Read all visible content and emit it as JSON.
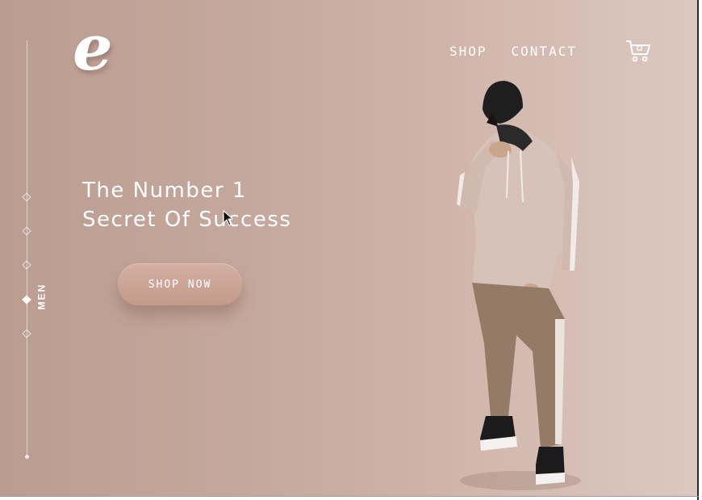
{
  "brand": {
    "logo_letter": "e"
  },
  "nav": {
    "items": [
      "SHOP",
      "CONTACT"
    ],
    "cart_icon": "cart-icon"
  },
  "sidebar": {
    "category_label": "MEN",
    "dots": 5,
    "active_index": 3
  },
  "hero": {
    "headline_line1": "The Number 1",
    "headline_line2": "Secret Of Success",
    "cta_label": "SHOP NOW"
  },
  "colors": {
    "background_start": "#bb9c91",
    "background_end": "#dcc8c0",
    "text": "#ffffff",
    "button": "#c9a394"
  }
}
